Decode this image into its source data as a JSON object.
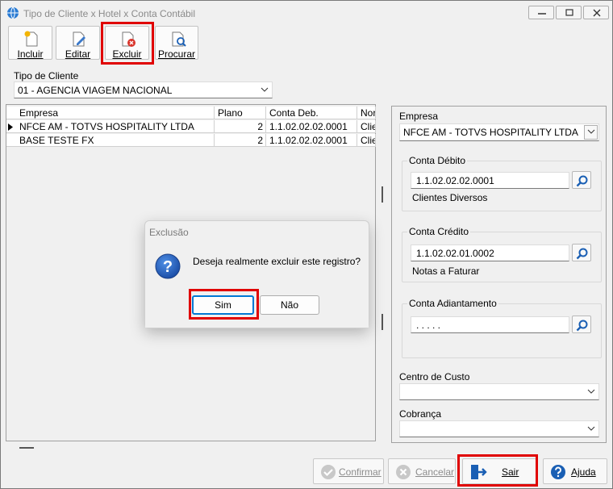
{
  "window": {
    "title": "Tipo de Cliente x Hotel x Conta Contábil"
  },
  "toolbar": {
    "incluir": "Incluir",
    "editar": "Editar",
    "excluir": "Excluir",
    "procurar": "Procurar"
  },
  "tipo_cliente": {
    "label": "Tipo de Cliente",
    "value": "01 - AGENCIA VIAGEM NACIONAL"
  },
  "grid": {
    "headers": [
      "Empresa",
      "Plano",
      "Conta Deb.",
      "Nor"
    ],
    "rows": [
      {
        "empresa": "NFCE AM - TOTVS HOSPITALITY LTDA",
        "plano": "2",
        "conta": "1.1.02.02.02.0001",
        "nor": "Clie"
      },
      {
        "empresa": "BASE TESTE FX",
        "plano": "2",
        "conta": "1.1.02.02.02.0001",
        "nor": "Clie"
      }
    ]
  },
  "detail": {
    "empresa_label": "Empresa",
    "empresa_value": "NFCE AM - TOTVS HOSPITALITY LTDA",
    "conta_debito": {
      "title": "Conta Débito",
      "value": "1.1.02.02.02.0001",
      "desc": "Clientes Diversos"
    },
    "conta_credito": {
      "title": "Conta Crédito",
      "value": "1.1.02.02.01.0002",
      "desc": "Notas a Faturar"
    },
    "conta_adiantamento": {
      "title": "Conta Adiantamento",
      "value": " .  .  .  .  ."
    },
    "centro_custo_label": "Centro de Custo",
    "cobranca_label": "Cobrança"
  },
  "dialog": {
    "title": "Exclusão",
    "message": "Deseja realmente excluir este registro?",
    "yes": "Sim",
    "no": "Não"
  },
  "footer": {
    "confirmar": "Confirmar",
    "cancelar": "Cancelar",
    "sair": "Sair",
    "ajuda": "Ajuda"
  },
  "colors": {
    "highlight": "#e00000",
    "accent": "#0078d4",
    "help_blue": "#1a5fb4"
  }
}
